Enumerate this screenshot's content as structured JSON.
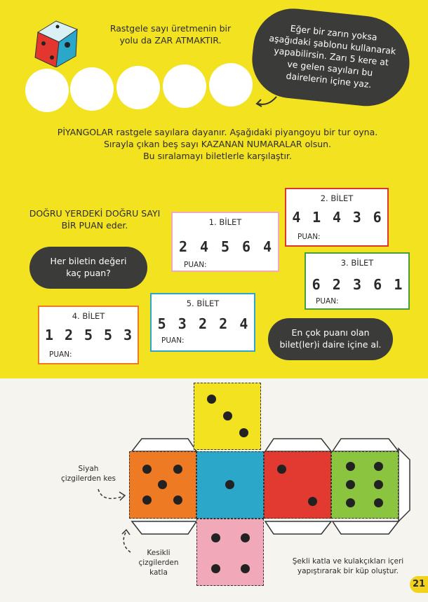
{
  "intro": {
    "line1": "Rastgele sayı üretmenin bir",
    "line2": "yolu da ZAR ATMAKTIR."
  },
  "instruction_bubble": {
    "lines": [
      "Eğer bir zarın yoksa",
      "aşağıdaki şablonu kullanarak",
      "yapabilirsin. Zarı 5 kere at",
      "ve gelen sayıları bu",
      "dairelerin içine yaz."
    ]
  },
  "lottery_text": {
    "lines": [
      "PİYANGOLAR rastgele sayılara dayanır. Aşağıdaki piyangoyu bir tur oyna.",
      "Sırayla çıkan beş sayı KAZANAN NUMARALAR olsun.",
      "Bu sıralamayı biletlerle karşılaştır."
    ]
  },
  "rule": {
    "line1": "DOĞRU YERDEKİ DOĞRU SAYI",
    "line2": "BİR PUAN eder."
  },
  "question_bubble": {
    "line1": "Her biletin değeri",
    "line2": "kaç puan?"
  },
  "circle_bubble": {
    "line1": "En çok puanı olan",
    "line2": "bilet(ler)i daire içine al."
  },
  "points_label": "PUAN:",
  "tickets": [
    {
      "title": "1. BİLET",
      "numbers": [
        "2",
        "4",
        "5",
        "6",
        "4"
      ],
      "color": "#f1a8b8"
    },
    {
      "title": "2. BİLET",
      "numbers": [
        "4",
        "1",
        "4",
        "3",
        "6"
      ],
      "color": "#e0362e"
    },
    {
      "title": "3. BİLET",
      "numbers": [
        "6",
        "2",
        "3",
        "6",
        "1"
      ],
      "color": "#4a9e3a"
    },
    {
      "title": "4. BİLET",
      "numbers": [
        "1",
        "2",
        "5",
        "5",
        "3"
      ],
      "color": "#ee7a23"
    },
    {
      "title": "5. BİLET",
      "numbers": [
        "5",
        "3",
        "2",
        "2",
        "4"
      ],
      "color": "#2aa7c9"
    }
  ],
  "net_labels": {
    "cut": [
      "Siyah",
      "çizgilerden kes"
    ],
    "fold": [
      "Kesikli",
      "çizgilerden",
      "katla"
    ],
    "assemble": [
      "Şekli katla ve kulakçıkları içeri",
      "yapıştırarak bir küp oluştur."
    ]
  },
  "page_number": "21",
  "colors": {
    "yellow": "#f2e21f",
    "orange": "#ee7a23",
    "blue": "#2aa7c9",
    "red": "#e23a31",
    "green": "#8bc53f",
    "pink": "#f1a8b8",
    "dark": "#3b3b39"
  }
}
